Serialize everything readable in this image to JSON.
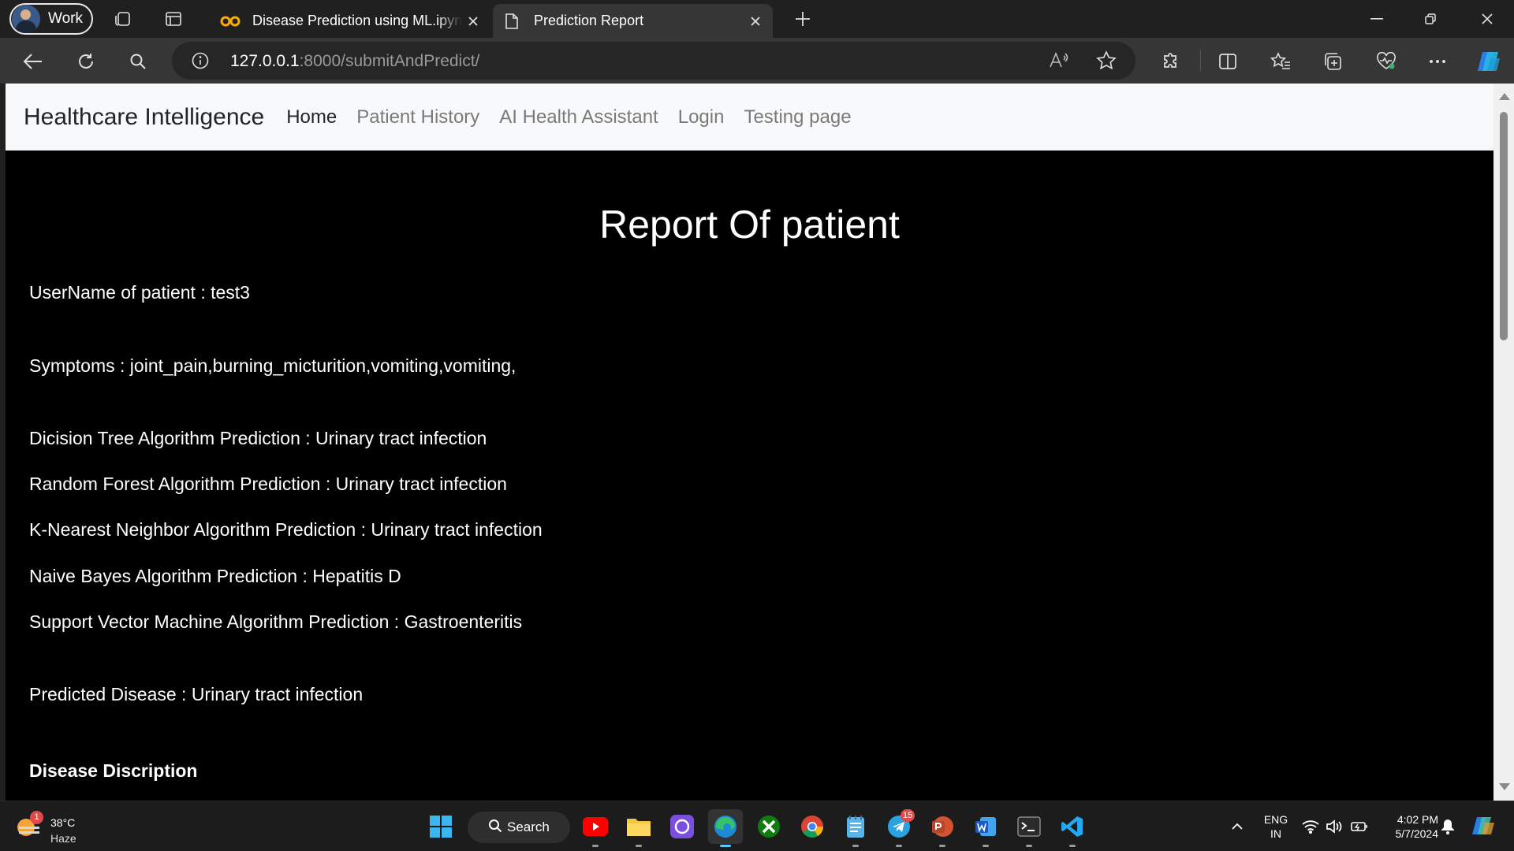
{
  "browser": {
    "profile_label": "Work",
    "tabs": [
      {
        "title": "Disease Prediction using ML.ipynb",
        "favicon": "colab-icon"
      },
      {
        "title": "Prediction Report",
        "favicon": "page-icon"
      }
    ],
    "url_host": "127.0.0.1",
    "url_rest": ":8000/submitAndPredict/"
  },
  "page": {
    "brand": "Healthcare Intelligence",
    "nav": [
      "Home",
      "Patient History",
      "AI Health Assistant",
      "Login",
      "Testing page"
    ],
    "heading": "Report Of patient",
    "username_line": "UserName of patient : test3",
    "symptoms_line": "Symptoms : joint_pain,burning_micturition,vomiting,vomiting,",
    "predictions": [
      "Dicision Tree Algorithm Prediction : Urinary tract infection",
      "Random Forest Algorithm Prediction : Urinary tract infection",
      "K-Nearest Neighbor Algorithm Prediction : Urinary tract infection",
      "Naive Bayes Algorithm Prediction : Hepatitis D",
      "Support Vector Machine Algorithm Prediction : Gastroenteritis"
    ],
    "predicted_line": "Predicted Disease : Urinary tract infection",
    "description_heading": "Disease Discription"
  },
  "taskbar": {
    "weather_temp": "38°C",
    "weather_cond": "Haze",
    "weather_badge": "1",
    "search_label": "Search",
    "telegram_badge": "15",
    "lang_1": "ENG",
    "lang_2": "IN",
    "time": "4:02 PM",
    "date": "5/7/2024"
  },
  "colors": {
    "page_background": "#000000",
    "navbar_background": "#f8f9fa",
    "accent": "#5cc8ff"
  }
}
